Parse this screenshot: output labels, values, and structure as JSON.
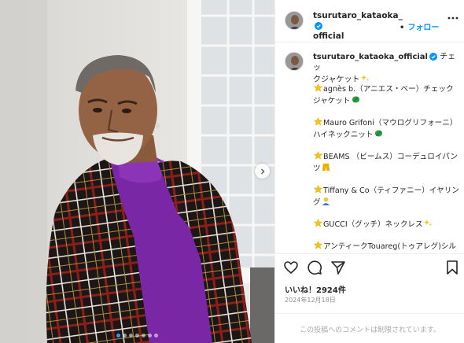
{
  "post": {
    "username": "tsurutaro_kataoka_official",
    "username_line1": "tsurutaro_kataoka_",
    "username_line2": "official",
    "follow_label": "フォロー",
    "separator": "•"
  },
  "caption": {
    "username": "tsurutaro_kataoka_official",
    "text_part1": " チェッ",
    "text_part2": "クジャケット",
    "items": [
      {
        "text": "agnès b.（アニエス・ベー）チェックジャケット",
        "emoji": "leaf"
      },
      {
        "text": "Mauro Grifoni（マウログリフォーニ）ハイネックニット",
        "emoji": "leaf"
      },
      {
        "text": "BEAMS （ビームス）コーデュロイパンツ",
        "emoji": "pants"
      },
      {
        "text": "Tiffany & Co（ティファニー）イヤリング",
        "emoji": "ear"
      },
      {
        "text": "GUCCI（グッチ）ネックレス",
        "emoji": "sparkle"
      },
      {
        "text": "アンティークTouareg(トゥアレグ)シルバーリング",
        "emoji": "ring"
      }
    ]
  },
  "stats": {
    "likes": "いいね！2924件",
    "date": "2024年12月18日"
  },
  "comments": {
    "disabled_text": "この投稿へのコメントは制限されています。"
  },
  "carousel": {
    "slide_count": 7,
    "active_index": 0
  },
  "colors": {
    "accent": "#0095f6",
    "verified": "#0095f6",
    "star": "#f5c518"
  }
}
